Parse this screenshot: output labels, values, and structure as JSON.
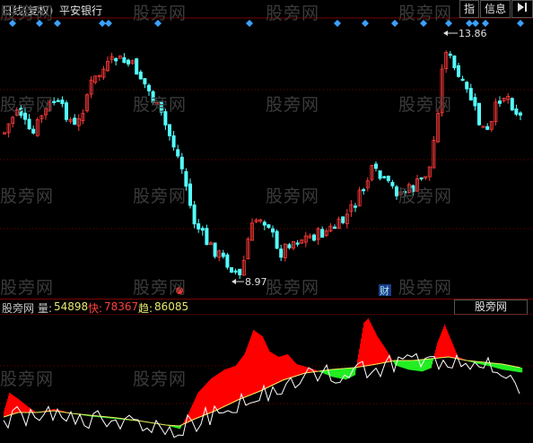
{
  "topbar": {
    "period_label": "日线(复权)",
    "stock_name": "平安银行",
    "btn_index": "指",
    "btn_info": "信息",
    "btn_collapse_icon": "collapse-right-icon"
  },
  "main_chart": {
    "high_label": "13.86",
    "low_label": "8.97",
    "finance_marker": "财",
    "colors": {
      "up": "#ff3a3a",
      "down": "#54ffff",
      "grid": "#7a0000",
      "diamond": "#3ca0ff"
    }
  },
  "indicator": {
    "name": "股旁网",
    "vol_label": "量:",
    "vol_value": "54898",
    "fast_label": "快:",
    "fast_value": "78367",
    "trend_label": "趋:",
    "trend_value": "86085",
    "tab_label": "股旁网",
    "colors": {
      "name": "#c8c8c8",
      "vol": "#e8e870",
      "fast": "#ff4040",
      "trend": "#e8e870",
      "fill_pos": "#ff0000",
      "fill_neg": "#22ee22"
    }
  },
  "watermarks": [
    "股旁网",
    "股旁网",
    "股旁网",
    "股旁网",
    "股旁网",
    "股旁网",
    "股旁网",
    "股旁网",
    "股旁网",
    "股旁网",
    "股旁网",
    "股旁网",
    "股旁网",
    "股旁网",
    "股旁网",
    "股旁网",
    "股旁网",
    "股旁网"
  ]
}
